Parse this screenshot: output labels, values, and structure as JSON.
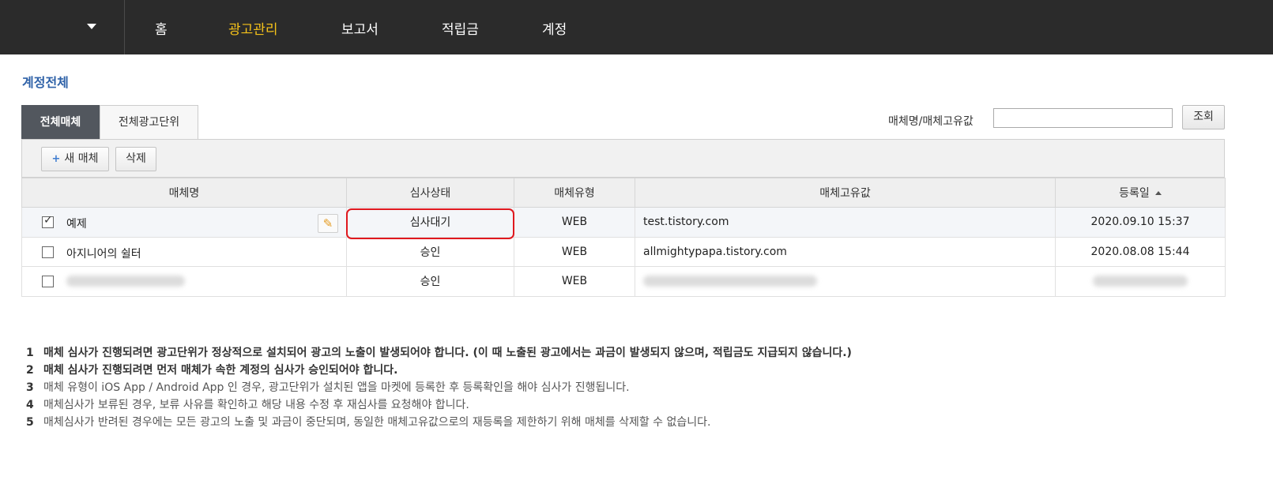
{
  "nav": {
    "items": [
      "홈",
      "광고관리",
      "보고서",
      "적립금",
      "계정"
    ],
    "active": "광고관리",
    "active_color": "#f4c11a"
  },
  "page": {
    "title": "계정전체"
  },
  "tabs": {
    "active": "전체매체",
    "inactive": "전체광고단위"
  },
  "search": {
    "label": "매체명/매체고유값",
    "value": "",
    "button": "조회"
  },
  "toolbar": {
    "new_label": "새 매체",
    "delete_label": "삭제"
  },
  "table": {
    "headers": [
      "매체명",
      "심사상태",
      "매체유형",
      "매체고유값",
      "등록일"
    ],
    "rows": [
      {
        "checked": true,
        "name": "예제",
        "status": "심사대기",
        "type": "WEB",
        "key": "test.tistory.com",
        "date": "2020.09.10 15:37"
      },
      {
        "checked": false,
        "name": "아지니어의 쉴터",
        "status": "승인",
        "type": "WEB",
        "key": "allmightypapa.tistory.com",
        "date": "2020.08.08 15:44"
      },
      {
        "checked": false,
        "name": "",
        "status": "승인",
        "type": "WEB",
        "key": "",
        "date": ""
      }
    ]
  },
  "notes": [
    {
      "num": "1",
      "text": "매체 심사가 진행되려면 광고단위가 정상적으로 설치되어 광고의 노출이 발생되어야 합니다. (이 때 노출된 광고에서는 과금이 발생되지 않으며, 적립금도 지급되지 않습니다.)"
    },
    {
      "num": "2",
      "text": "매체 심사가 진행되려면 먼저 매체가 속한 계정의 심사가 승인되어야 합니다."
    },
    {
      "num": "3",
      "text": "매체 유형이 iOS App / Android App 인 경우, 광고단위가 설치된 앱을 마켓에 등록한 후 등록확인을 해야 심사가 진행됩니다."
    },
    {
      "num": "4",
      "text": "매체심사가 보류된 경우, 보류 사유를 확인하고 해당 내용 수정 후 재심사를 요청해야 합니다."
    },
    {
      "num": "5",
      "text": "매체심사가 반려된 경우에는 모든 광고의 노출 및 과금이 중단되며, 동일한 매체고유값으로의 재등록을 제한하기 위해 매체를 삭제할 수 없습니다."
    }
  ],
  "colors": {
    "topbar": "#2b2b2b",
    "title": "#2f62a8",
    "highlight": "#e0191f"
  }
}
